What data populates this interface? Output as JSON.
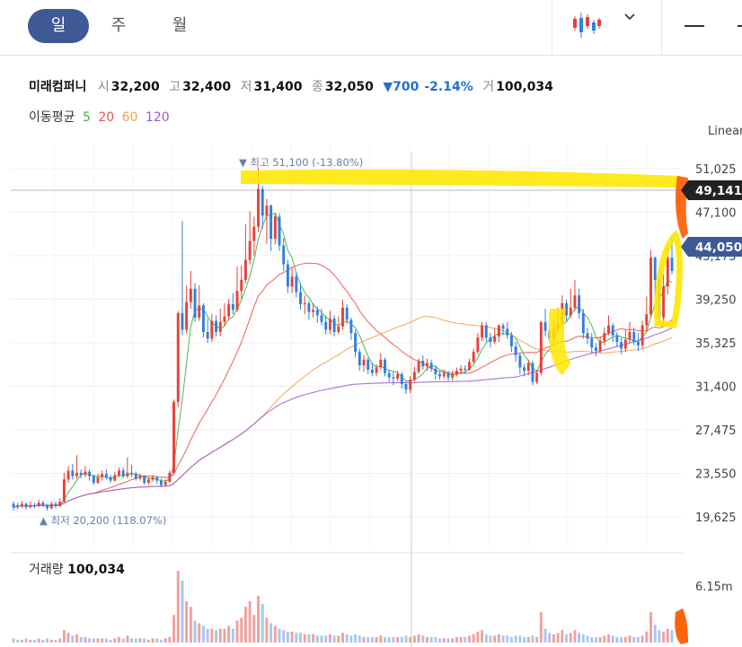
{
  "tabs": [
    {
      "label": "일",
      "active": true
    },
    {
      "label": "주",
      "active": false
    },
    {
      "label": "월",
      "active": false
    }
  ],
  "stock": {
    "name": "미래컴퍼니",
    "open_label": "시",
    "open": "32,200",
    "high_label": "고",
    "high": "32,400",
    "low_label": "저",
    "low": "31,400",
    "close_label": "종",
    "close": "32,050",
    "change": "▼700",
    "change_pct": "-2.14%",
    "volume_label": "거",
    "volume": "100,034"
  },
  "moving_average": {
    "label": "이동평균",
    "periods": [
      {
        "label": "5",
        "color": "#3fb14a"
      },
      {
        "label": "20",
        "color": "#e8554e"
      },
      {
        "label": "60",
        "color": "#f0a04b"
      },
      {
        "label": "120",
        "color": "#9b59d0"
      }
    ]
  },
  "scale_label": "Linear",
  "chart": {
    "max_annotation": "▼ 최고 51,100 (-13.80%)",
    "min_annotation": "▲ 최저 20,200 (118.07%)",
    "y_ticks": [
      "51,025",
      "47,100",
      "43,175",
      "39,250",
      "35,325",
      "31,400",
      "27,475",
      "23,550",
      "19,625"
    ],
    "price_tag_1": "49,141",
    "price_tag_2": "44,050"
  },
  "volume_panel": {
    "label": "거래량",
    "value": "100,034",
    "tick": "6.15m"
  },
  "colors": {
    "up": "#e8403a",
    "down": "#2f7fe0",
    "tab_active": "#3d5a97",
    "highlight_yellow": "#ffe600",
    "highlight_orange": "#ff5a00"
  },
  "chart_data": {
    "type": "candlestick",
    "y_range": [
      19625,
      51025
    ],
    "candles": [
      [
        20800,
        20500,
        21000,
        20200
      ],
      [
        20700,
        20600,
        20900,
        20300
      ],
      [
        20600,
        20800,
        21100,
        20400
      ],
      [
        20800,
        20500,
        20900,
        20300
      ],
      [
        20500,
        20700,
        21000,
        20400
      ],
      [
        20700,
        20600,
        20900,
        20400
      ],
      [
        20600,
        20900,
        21200,
        20500
      ],
      [
        20900,
        20700,
        21100,
        20500
      ],
      [
        20700,
        20400,
        20800,
        20200
      ],
      [
        20400,
        20800,
        21000,
        20300
      ],
      [
        20800,
        20600,
        21000,
        20400
      ],
      [
        20600,
        21000,
        21300,
        20500
      ],
      [
        21000,
        23000,
        23600,
        20900
      ],
      [
        23000,
        23800,
        24200,
        22700
      ],
      [
        23800,
        23300,
        24400,
        23000
      ],
      [
        23300,
        23600,
        25200,
        23100
      ],
      [
        23600,
        23400,
        23900,
        23100
      ],
      [
        23400,
        23700,
        24200,
        23200
      ],
      [
        23700,
        23300,
        23900,
        22900
      ],
      [
        23300,
        22700,
        23400,
        22500
      ],
      [
        22700,
        23200,
        23500,
        22600
      ],
      [
        23200,
        23500,
        23800,
        22900
      ],
      [
        23500,
        23200,
        23900,
        23000
      ],
      [
        23200,
        22900,
        23400,
        22700
      ],
      [
        22900,
        23400,
        23700,
        22800
      ],
      [
        23400,
        23800,
        24100,
        23200
      ],
      [
        23800,
        23300,
        24100,
        23100
      ],
      [
        23300,
        23600,
        25000,
        23100
      ],
      [
        23600,
        23500,
        24300,
        23200
      ],
      [
        23500,
        23100,
        23700,
        22900
      ],
      [
        23100,
        23300,
        23500,
        22900
      ],
      [
        23300,
        22700,
        23400,
        22500
      ],
      [
        22700,
        23000,
        23200,
        22500
      ],
      [
        23000,
        23200,
        23400,
        22800
      ],
      [
        23200,
        22900,
        23300,
        22600
      ],
      [
        22900,
        22500,
        23100,
        22300
      ],
      [
        22500,
        22800,
        23000,
        22400
      ],
      [
        22800,
        23600,
        23800,
        22700
      ],
      [
        23600,
        30000,
        30200,
        23400
      ],
      [
        30000,
        38000,
        38200,
        29500
      ],
      [
        38000,
        36500,
        46300,
        36000
      ],
      [
        36500,
        39000,
        40500,
        36200
      ],
      [
        39000,
        40200,
        41800,
        38400
      ],
      [
        40200,
        37600,
        40700,
        37200
      ],
      [
        37600,
        38700,
        40500,
        37300
      ],
      [
        38700,
        36300,
        38900,
        35800
      ],
      [
        36300,
        35700,
        37500,
        35300
      ],
      [
        35700,
        37300,
        37900,
        35400
      ],
      [
        37300,
        36300,
        37800,
        35900
      ],
      [
        36300,
        37200,
        38400,
        35900
      ],
      [
        37200,
        37700,
        38900,
        36800
      ],
      [
        37700,
        38800,
        39300,
        37400
      ],
      [
        38800,
        38300,
        39800,
        37900
      ],
      [
        38300,
        40000,
        42200,
        38100
      ],
      [
        40000,
        41000,
        42300,
        39300
      ],
      [
        41000,
        42800,
        46000,
        40700
      ],
      [
        42800,
        44500,
        47200,
        42400
      ],
      [
        44500,
        45800,
        46700,
        43200
      ],
      [
        45800,
        49200,
        51100,
        45300
      ],
      [
        49200,
        46800,
        49500,
        45600
      ],
      [
        46800,
        47700,
        48300,
        44200
      ],
      [
        47700,
        44700,
        47800,
        43600
      ],
      [
        44700,
        46700,
        47000,
        44200
      ],
      [
        46700,
        44100,
        47000,
        43600
      ],
      [
        44100,
        42400,
        44800,
        41800
      ],
      [
        42400,
        40400,
        42800,
        39800
      ],
      [
        40400,
        41300,
        42100,
        39800
      ],
      [
        41300,
        39900,
        41700,
        39400
      ],
      [
        39900,
        38800,
        40700,
        38300
      ],
      [
        38800,
        38900,
        39600,
        37900
      ],
      [
        38900,
        38100,
        39100,
        37400
      ],
      [
        38100,
        38300,
        38900,
        37600
      ],
      [
        38300,
        37800,
        38600,
        37100
      ],
      [
        37800,
        37200,
        38400,
        36900
      ],
      [
        37200,
        36500,
        37800,
        36100
      ],
      [
        36500,
        37500,
        38200,
        36100
      ],
      [
        37500,
        36300,
        37800,
        35900
      ],
      [
        36300,
        36800,
        37700,
        36100
      ],
      [
        36800,
        38500,
        39200,
        36500
      ],
      [
        38500,
        37400,
        38800,
        37000
      ],
      [
        37400,
        36200,
        37600,
        35600
      ],
      [
        36200,
        34500,
        36500,
        34000
      ],
      [
        34500,
        33300,
        34800,
        32800
      ],
      [
        33300,
        33800,
        34200,
        32700
      ],
      [
        33800,
        32900,
        34000,
        32500
      ],
      [
        32900,
        32600,
        33500,
        32300
      ],
      [
        32600,
        33100,
        33400,
        32300
      ],
      [
        33100,
        33800,
        34400,
        32900
      ],
      [
        33800,
        32600,
        34000,
        32300
      ],
      [
        32600,
        32200,
        32900,
        31800
      ],
      [
        32200,
        32100,
        32700,
        31500
      ],
      [
        32100,
        32500,
        32800,
        31900
      ],
      [
        32500,
        31600,
        32700,
        31200
      ],
      [
        31600,
        31100,
        31900,
        30700
      ],
      [
        31100,
        32000,
        32300,
        30800
      ],
      [
        32000,
        32700,
        33200,
        31800
      ],
      [
        32700,
        33700,
        33900,
        32500
      ],
      [
        33700,
        33200,
        34200,
        32900
      ],
      [
        33200,
        33500,
        33900,
        32800
      ],
      [
        33500,
        33000,
        33800,
        32700
      ],
      [
        33000,
        32500,
        33300,
        32000
      ],
      [
        32500,
        32300,
        32800,
        32000
      ],
      [
        32300,
        32600,
        32900,
        32100
      ],
      [
        32600,
        32200,
        32800,
        31900
      ],
      [
        32200,
        32500,
        32800,
        31900
      ],
      [
        32500,
        32800,
        33100,
        32300
      ],
      [
        32800,
        33000,
        33300,
        32500
      ],
      [
        33000,
        32900,
        33300,
        32600
      ],
      [
        32900,
        33600,
        33900,
        32800
      ],
      [
        33600,
        34500,
        34800,
        33500
      ],
      [
        34500,
        35800,
        36200,
        34300
      ],
      [
        35800,
        36900,
        37200,
        35500
      ],
      [
        36900,
        35800,
        37200,
        35400
      ],
      [
        35800,
        35400,
        36200,
        34900
      ],
      [
        35400,
        35900,
        36600,
        35200
      ],
      [
        35900,
        36900,
        37000,
        35400
      ],
      [
        36900,
        36600,
        37100,
        36000
      ],
      [
        36600,
        36000,
        37200,
        35700
      ],
      [
        36000,
        35000,
        36300,
        34500
      ],
      [
        35000,
        34200,
        35400,
        33600
      ],
      [
        34200,
        33100,
        34400,
        32500
      ],
      [
        33100,
        32800,
        33400,
        32300
      ],
      [
        32800,
        33500,
        33800,
        32400
      ],
      [
        33500,
        31800,
        33700,
        31500
      ],
      [
        31800,
        32600,
        32900,
        31600
      ],
      [
        32600,
        37200,
        37300,
        32400
      ],
      [
        37200,
        36400,
        38400,
        35900
      ],
      [
        36400,
        35700,
        36800,
        35400
      ],
      [
        35700,
        36600,
        37400,
        35400
      ],
      [
        36600,
        37100,
        38500,
        36300
      ],
      [
        37100,
        38900,
        39600,
        36900
      ],
      [
        38900,
        37800,
        39200,
        37300
      ],
      [
        37800,
        38500,
        40200,
        37600
      ],
      [
        38500,
        39600,
        41000,
        38200
      ],
      [
        39600,
        38000,
        40200,
        37500
      ],
      [
        38000,
        36200,
        38400,
        35700
      ],
      [
        36200,
        35700,
        36700,
        35200
      ],
      [
        35700,
        34900,
        36200,
        34400
      ],
      [
        34900,
        34600,
        35300,
        34100
      ],
      [
        34600,
        35500,
        35900,
        34400
      ],
      [
        35500,
        36200,
        36700,
        35100
      ],
      [
        36200,
        36900,
        37800,
        36000
      ],
      [
        36900,
        36000,
        37100,
        35400
      ],
      [
        36000,
        35400,
        36300,
        34900
      ],
      [
        35400,
        34800,
        35800,
        34300
      ],
      [
        34800,
        35600,
        36500,
        34500
      ],
      [
        35600,
        36300,
        37200,
        35300
      ],
      [
        36300,
        35400,
        36700,
        35100
      ],
      [
        35400,
        35100,
        36200,
        34600
      ],
      [
        35100,
        36900,
        37300,
        34800
      ],
      [
        36900,
        37900,
        39500,
        36400
      ],
      [
        37900,
        43000,
        43700,
        37600
      ],
      [
        43000,
        41000,
        43100,
        39500
      ],
      [
        41000,
        37600,
        42100,
        37000
      ],
      [
        37600,
        40400,
        41500,
        37000
      ],
      [
        40400,
        43000,
        44000,
        39700
      ],
      [
        43000,
        41800,
        44800,
        41500
      ]
    ],
    "volume": [
      3,
      2,
      2,
      3,
      2,
      2,
      3,
      2,
      3,
      2,
      2,
      3,
      9,
      7,
      5,
      6,
      4,
      4,
      3,
      3,
      3,
      3,
      3,
      2,
      3,
      4,
      3,
      5,
      3,
      3,
      3,
      3,
      2,
      3,
      3,
      2,
      3,
      4,
      20,
      52,
      45,
      30,
      26,
      16,
      14,
      12,
      10,
      10,
      9,
      10,
      10,
      12,
      10,
      16,
      18,
      26,
      30,
      20,
      34,
      28,
      18,
      14,
      12,
      10,
      9,
      8,
      8,
      7,
      7,
      6,
      6,
      6,
      5,
      5,
      5,
      6,
      5,
      5,
      7,
      6,
      5,
      6,
      5,
      4,
      4,
      4,
      4,
      5,
      4,
      4,
      4,
      4,
      4,
      5,
      4,
      5,
      6,
      5,
      4,
      4,
      4,
      3,
      3,
      3,
      3,
      4,
      4,
      4,
      5,
      6,
      8,
      9,
      6,
      5,
      5,
      6,
      5,
      5,
      4,
      5,
      5,
      4,
      4,
      5,
      4,
      22,
      10,
      7,
      6,
      7,
      9,
      6,
      7,
      9,
      7,
      6,
      5,
      4,
      4,
      4,
      5,
      6,
      5,
      4,
      4,
      4,
      5,
      4,
      4,
      5,
      8,
      22,
      13,
      9,
      8,
      10,
      9
    ]
  }
}
